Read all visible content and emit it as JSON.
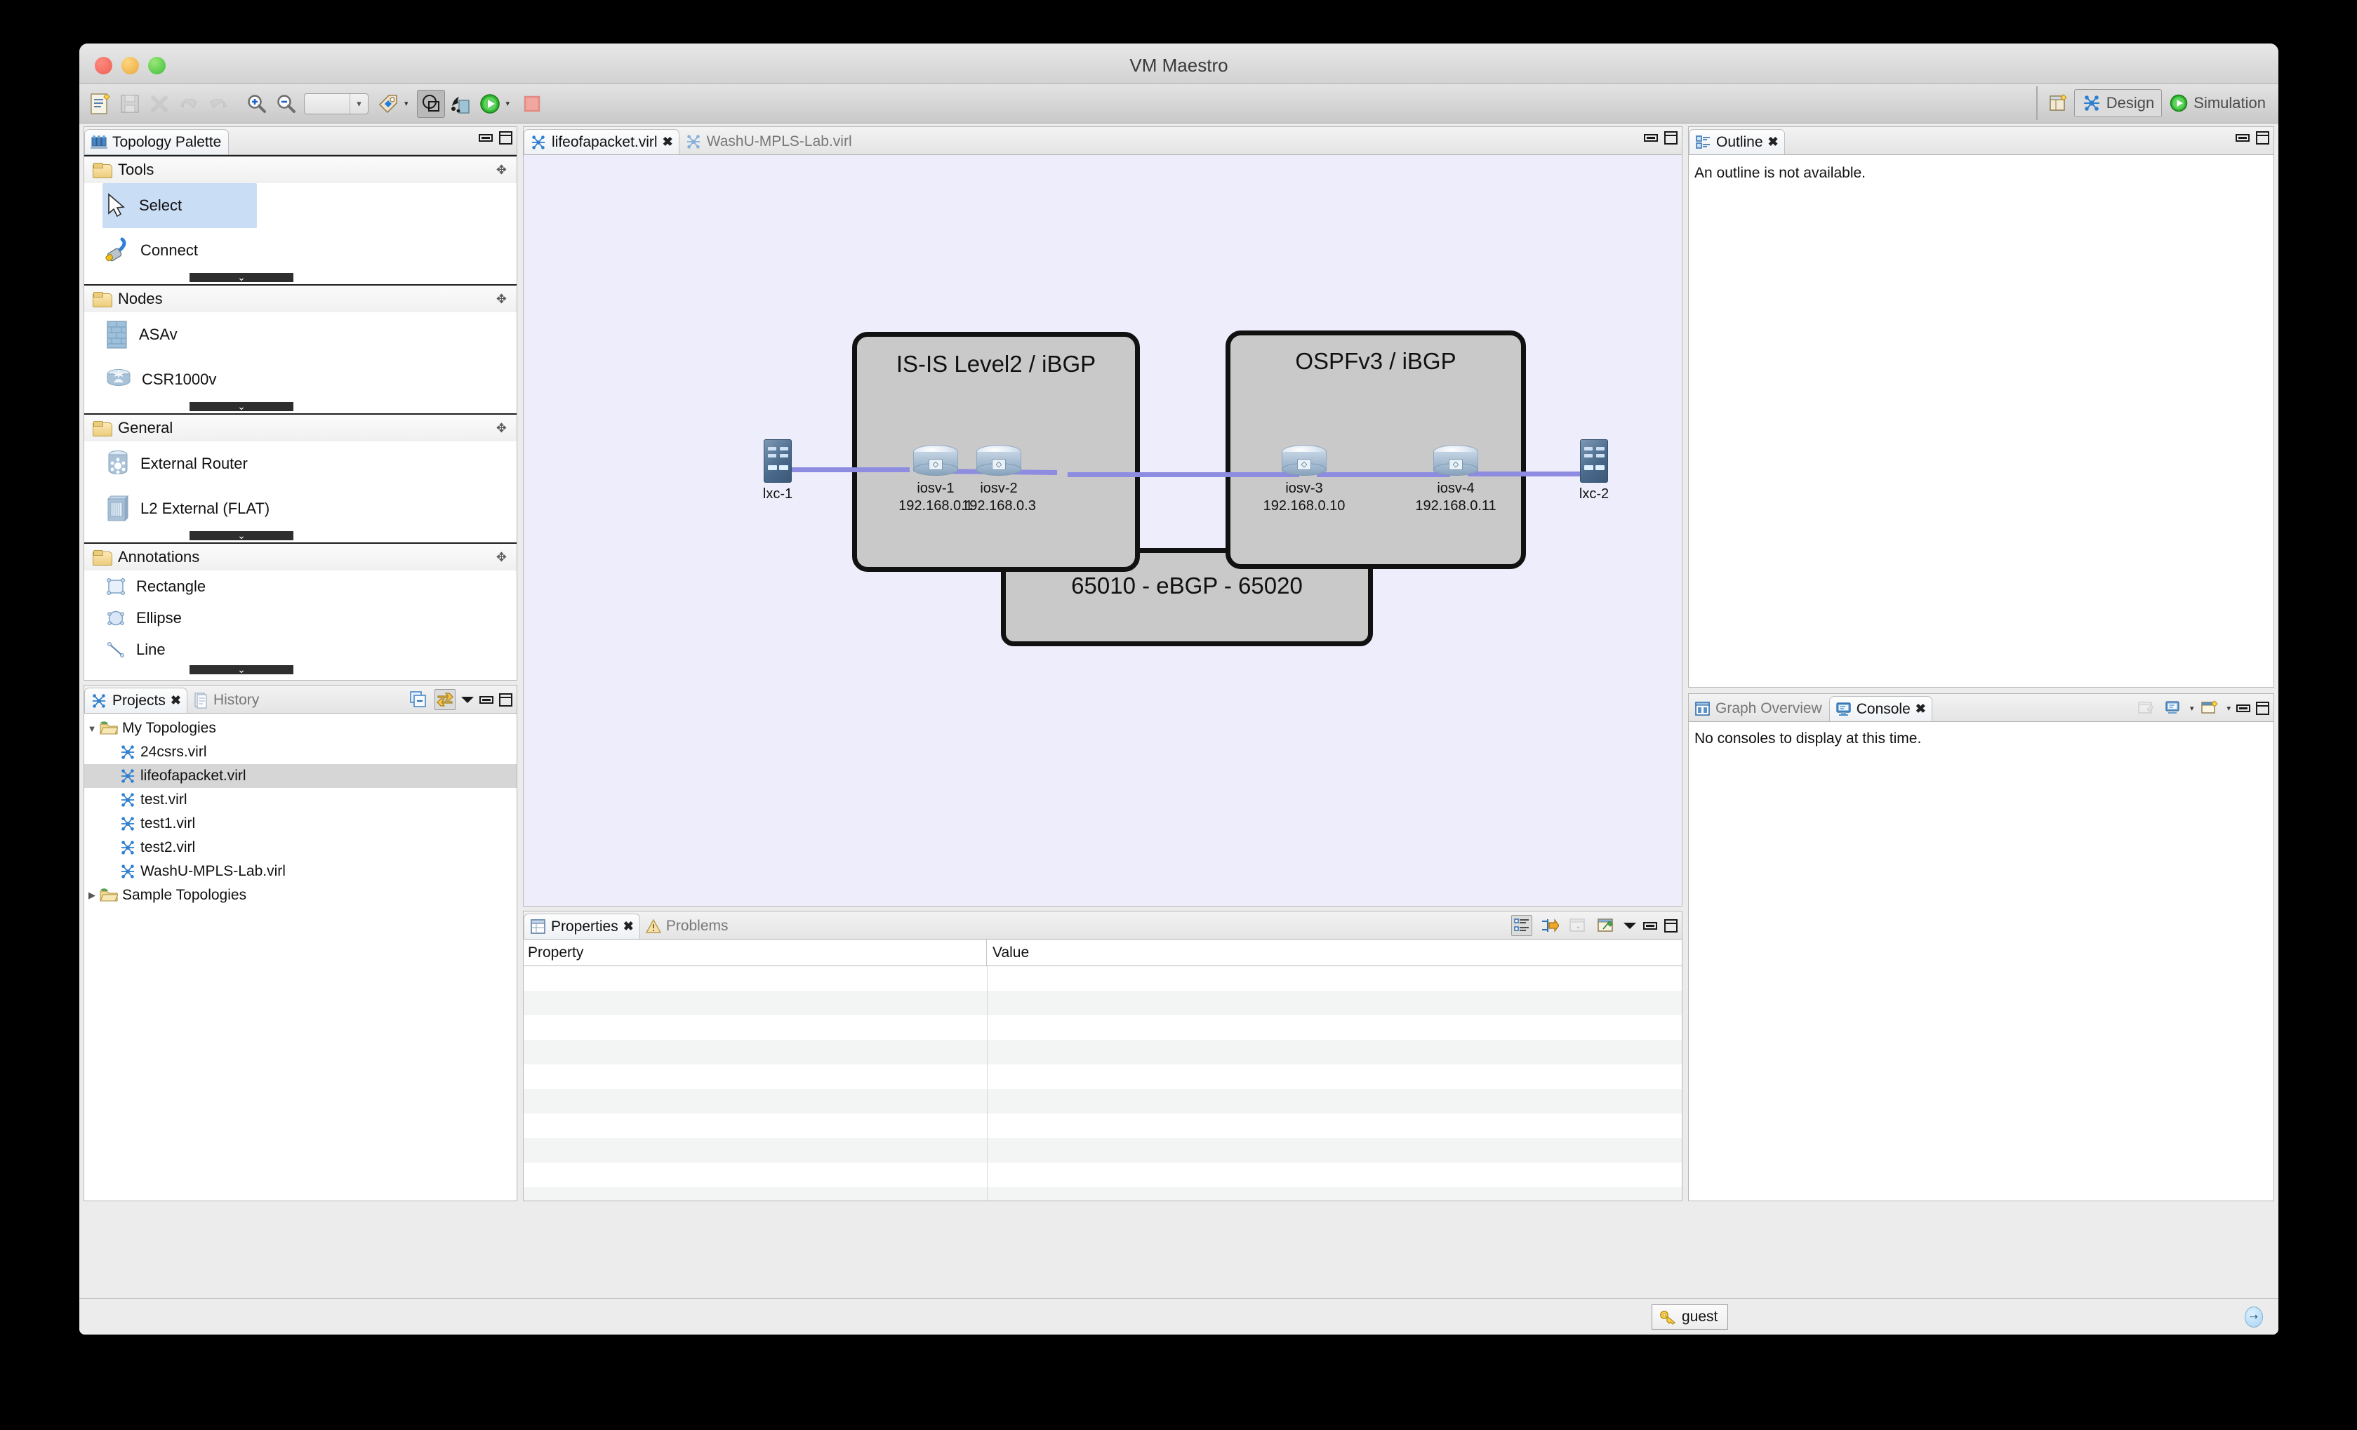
{
  "window": {
    "title": "VM Maestro",
    "controls": {
      "close": "close-button",
      "minimize": "minimize-button",
      "zoom": "zoom-button"
    }
  },
  "toolbar": {
    "buttons": [
      {
        "name": "new-topology",
        "icon": "new-document-icon",
        "enabled": true
      },
      {
        "name": "save",
        "icon": "save-icon",
        "enabled": false
      },
      {
        "name": "delete",
        "icon": "delete-x-icon",
        "enabled": false
      },
      {
        "name": "undo",
        "icon": "undo-arrow-icon",
        "enabled": false
      },
      {
        "name": "redo",
        "icon": "redo-arrow-icon",
        "enabled": false
      },
      {
        "name": "zoom-in",
        "icon": "zoom-in-icon",
        "enabled": true
      },
      {
        "name": "zoom-out",
        "icon": "zoom-out-icon",
        "enabled": true
      }
    ],
    "zoom_combo_value": "",
    "tag_button": "tag-icon",
    "overlay_button": "overlay-shapes-icon",
    "build_button": "build-icon",
    "launch_button": "launch-play-icon",
    "stop_button": "stop-square-icon"
  },
  "perspective": {
    "extra_icon": "new-perspective-icon",
    "items": [
      {
        "label": "Design",
        "icon": "design-topology-icon",
        "active": true
      },
      {
        "label": "Simulation",
        "icon": "simulation-play-icon",
        "active": false
      }
    ]
  },
  "palette": {
    "tab_label": "Topology Palette",
    "tab_icon": "palette-icon",
    "groups": [
      {
        "label": "Tools",
        "items": [
          {
            "label": "Select",
            "icon": "cursor-arrow-icon",
            "selected": true
          },
          {
            "label": "Connect",
            "icon": "connector-plug-icon",
            "selected": false
          }
        ]
      },
      {
        "label": "Nodes",
        "items": [
          {
            "label": "ASAv",
            "icon": "firewall-brick-icon",
            "selected": false
          },
          {
            "label": "CSR1000v",
            "icon": "cloud-router-icon",
            "selected": false
          }
        ]
      },
      {
        "label": "General",
        "items": [
          {
            "label": "External Router",
            "icon": "external-router-icon",
            "selected": false
          },
          {
            "label": "L2 External (FLAT)",
            "icon": "l2-switch-icon",
            "selected": false
          }
        ]
      },
      {
        "label": "Annotations",
        "items": [
          {
            "label": "Rectangle",
            "icon": "rectangle-shape-icon",
            "selected": false
          },
          {
            "label": "Ellipse",
            "icon": "ellipse-shape-icon",
            "selected": false
          },
          {
            "label": "Line",
            "icon": "line-shape-icon",
            "selected": false
          }
        ]
      }
    ]
  },
  "projects": {
    "tabs": [
      {
        "label": "Projects",
        "icon": "topology-icon",
        "active": true,
        "closable": true
      },
      {
        "label": "History",
        "icon": "history-icon",
        "active": false,
        "closable": false
      }
    ],
    "toolbar": [
      {
        "name": "collapse-all-button",
        "icon": "collapse-all-icon",
        "active": false
      },
      {
        "name": "link-with-editor-button",
        "icon": "link-editor-icon",
        "active": true
      },
      {
        "name": "view-menu-button",
        "icon": "chevron-down-icon",
        "active": false
      },
      {
        "name": "minimize-button",
        "icon": "minimize-icon",
        "active": false
      },
      {
        "name": "maximize-button",
        "icon": "maximize-icon",
        "active": false
      }
    ],
    "tree": [
      {
        "label": "My Topologies",
        "icon": "project-folder-icon",
        "depth": 0,
        "twisty": "open",
        "selected": false
      },
      {
        "label": "24csrs.virl",
        "icon": "topology-icon",
        "depth": 1,
        "twisty": "none",
        "selected": false
      },
      {
        "label": "lifeofapacket.virl",
        "icon": "topology-icon",
        "depth": 1,
        "twisty": "none",
        "selected": true
      },
      {
        "label": "test.virl",
        "icon": "topology-icon",
        "depth": 1,
        "twisty": "none",
        "selected": false
      },
      {
        "label": "test1.virl",
        "icon": "topology-icon",
        "depth": 1,
        "twisty": "none",
        "selected": false
      },
      {
        "label": "test2.virl",
        "icon": "topology-icon",
        "depth": 1,
        "twisty": "none",
        "selected": false
      },
      {
        "label": "WashU-MPLS-Lab.virl",
        "icon": "topology-icon",
        "depth": 1,
        "twisty": "none",
        "selected": false
      },
      {
        "label": "Sample Topologies",
        "icon": "project-folder-icon",
        "depth": 0,
        "twisty": "closed",
        "selected": false
      }
    ]
  },
  "editor": {
    "tabs": [
      {
        "label": "lifeofapacket.virl",
        "icon": "topology-icon",
        "active": true,
        "closable": true
      },
      {
        "label": "WashU-MPLS-Lab.virl",
        "icon": "topology-icon",
        "active": false,
        "closable": false
      }
    ],
    "canvas_background": "#eeedfb"
  },
  "topology": {
    "groups": [
      {
        "name": "as-65010",
        "label": "IS-IS Level2 / iBGP"
      },
      {
        "name": "as-65020",
        "label": "OSPFv3 / iBGP"
      },
      {
        "name": "ebgp-peering",
        "label": "65010 - eBGP - 65020"
      }
    ],
    "nodes": [
      {
        "name": "lxc-1",
        "label": "lxc-1",
        "ip": "",
        "type": "server"
      },
      {
        "name": "iosv-1",
        "label": "iosv-1",
        "ip": "192.168.0.1",
        "type": "router"
      },
      {
        "name": "iosv-2",
        "label": "iosv-2",
        "ip": "192.168.0.3",
        "type": "router"
      },
      {
        "name": "iosv-3",
        "label": "iosv-3",
        "ip": "192.168.0.10",
        "type": "router"
      },
      {
        "name": "iosv-4",
        "label": "iosv-4",
        "ip": "192.168.0.11",
        "type": "router"
      },
      {
        "name": "lxc-2",
        "label": "lxc-2",
        "ip": "",
        "type": "server"
      }
    ],
    "link_color": "#8d8ce0",
    "group_fill": "#c9c9c9",
    "group_border": "#111111"
  },
  "properties": {
    "tabs": [
      {
        "label": "Properties",
        "icon": "properties-table-icon",
        "active": true,
        "closable": true
      },
      {
        "label": "Problems",
        "icon": "warning-triangle-icon",
        "active": false,
        "closable": false
      }
    ],
    "toolbar": [
      {
        "name": "show-categories-button",
        "icon": "categories-icon",
        "active": true
      },
      {
        "name": "show-advanced-button",
        "icon": "advanced-arrow-icon",
        "active": false
      },
      {
        "name": "restore-defaults-button",
        "icon": "restore-icon",
        "active": false
      },
      {
        "name": "pin-to-selection-button",
        "icon": "pin-window-icon",
        "active": false
      },
      {
        "name": "view-menu-button",
        "icon": "chevron-down-icon",
        "active": false
      },
      {
        "name": "minimize-button",
        "icon": "minimize-icon",
        "active": false
      },
      {
        "name": "maximize-button",
        "icon": "maximize-icon",
        "active": false
      }
    ],
    "columns": [
      "Property",
      "Value"
    ],
    "rows": []
  },
  "outline": {
    "tab_label": "Outline",
    "tab_icon": "outline-icon",
    "message": "An outline is not available.",
    "toolbar": [
      {
        "name": "minimize-button",
        "icon": "minimize-icon"
      },
      {
        "name": "maximize-button",
        "icon": "maximize-icon"
      }
    ]
  },
  "console": {
    "tabs": [
      {
        "label": "Graph Overview",
        "icon": "graph-overview-icon",
        "active": false,
        "closable": false
      },
      {
        "label": "Console",
        "icon": "console-monitor-icon",
        "active": true,
        "closable": true
      }
    ],
    "message": "No consoles to display at this time.",
    "toolbar": [
      {
        "name": "clear-console-button",
        "icon": "clear-console-icon",
        "enabled": false
      },
      {
        "name": "display-selected-console-button",
        "icon": "display-console-icon",
        "enabled": true
      },
      {
        "name": "open-console-button",
        "icon": "open-console-icon",
        "enabled": true
      },
      {
        "name": "minimize-button",
        "icon": "minimize-icon",
        "enabled": true
      },
      {
        "name": "maximize-button",
        "icon": "maximize-icon",
        "enabled": true
      }
    ]
  },
  "statusbar": {
    "user_label": "guest",
    "user_icon": "key-icon",
    "right_icon": "globe-link-icon"
  }
}
